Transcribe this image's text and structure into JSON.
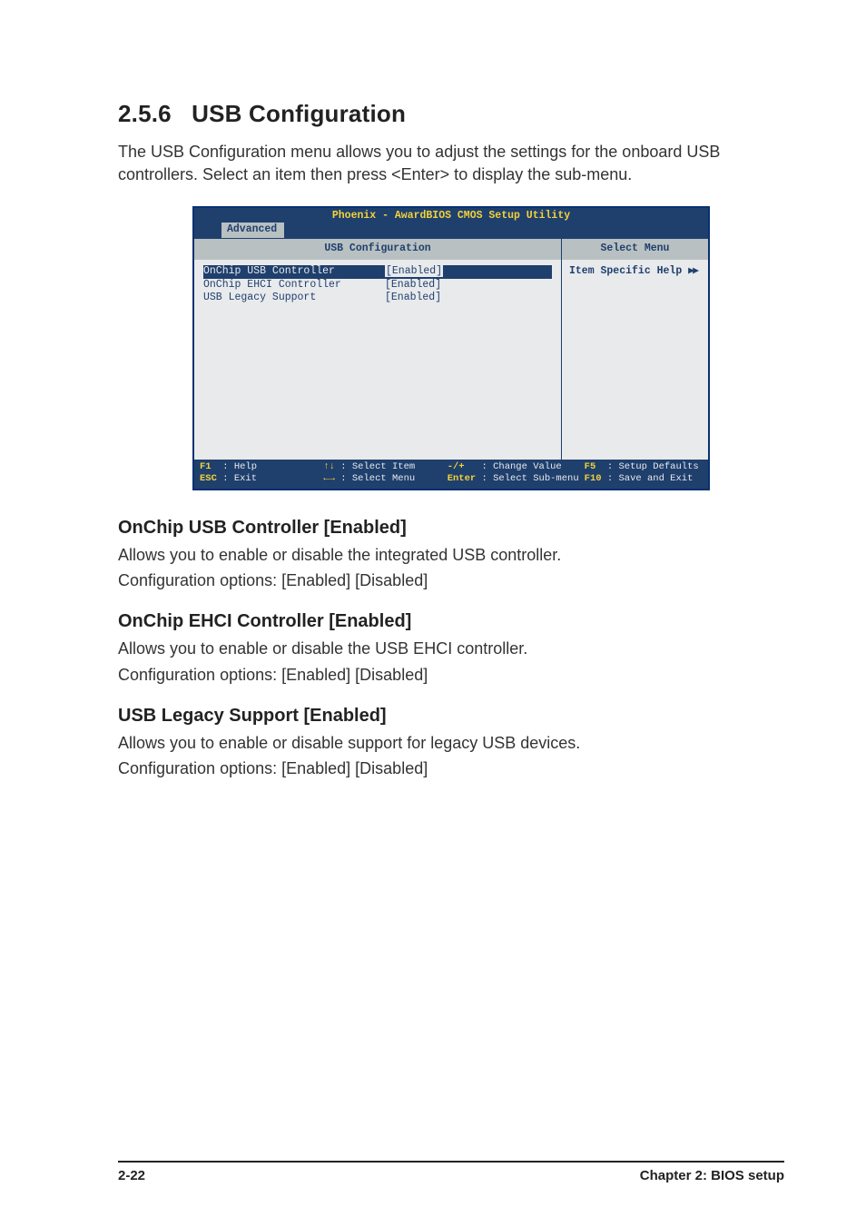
{
  "section": {
    "number": "2.5.6",
    "title": "USB Configuration",
    "intro": "The USB Configuration menu allows you to adjust the settings for the onboard USB controllers. Select an item then press <Enter> to display the sub-menu."
  },
  "bios": {
    "topbar": "Phoenix - AwardBIOS CMOS Setup Utility",
    "tab": "Advanced",
    "header_main": "USB Configuration",
    "header_side": "Select Menu",
    "rows": [
      {
        "label": "OnChip USB Controller",
        "value": "[Enabled]",
        "selected": true
      },
      {
        "label": "OnChip EHCI Controller",
        "value": "[Enabled]",
        "selected": false
      },
      {
        "label": "USB Legacy Support",
        "value": "[Enabled]",
        "selected": false
      }
    ],
    "help_text": "Item Specific Help",
    "arrows": "▶▶",
    "footer": {
      "f1": {
        "key": "F1",
        "label": ": Help"
      },
      "esc": {
        "key": "ESC",
        "label": ": Exit"
      },
      "up": {
        "key": "↑↓",
        "label": ": Select Item"
      },
      "lr": {
        "key": "←→",
        "label": ": Select Menu"
      },
      "pm": {
        "key": "-/+",
        "label": ": Change Value"
      },
      "ent": {
        "key": "Enter",
        "label": ": Select Sub-menu"
      },
      "f5": {
        "key": "F5",
        "label": ": Setup Defaults"
      },
      "f10": {
        "key": "F10",
        "label": ": Save and Exit"
      }
    }
  },
  "options": {
    "usb_ctrl": {
      "title": "OnChip USB Controller [Enabled]",
      "desc1": "Allows you to enable or disable the integrated USB controller.",
      "desc2": "Configuration options: [Enabled] [Disabled]"
    },
    "ehci_ctrl": {
      "title": "OnChip EHCI Controller [Enabled]",
      "desc1": "Allows you to enable or disable the USB EHCI controller.",
      "desc2": "Configuration options: [Enabled] [Disabled]"
    },
    "legacy": {
      "title": "USB Legacy Support [Enabled]",
      "desc1": "Allows you to enable or disable support for legacy USB devices.",
      "desc2": "Configuration options: [Enabled] [Disabled]"
    }
  },
  "footer": {
    "page": "2-22",
    "chapter": "Chapter 2: BIOS setup"
  }
}
